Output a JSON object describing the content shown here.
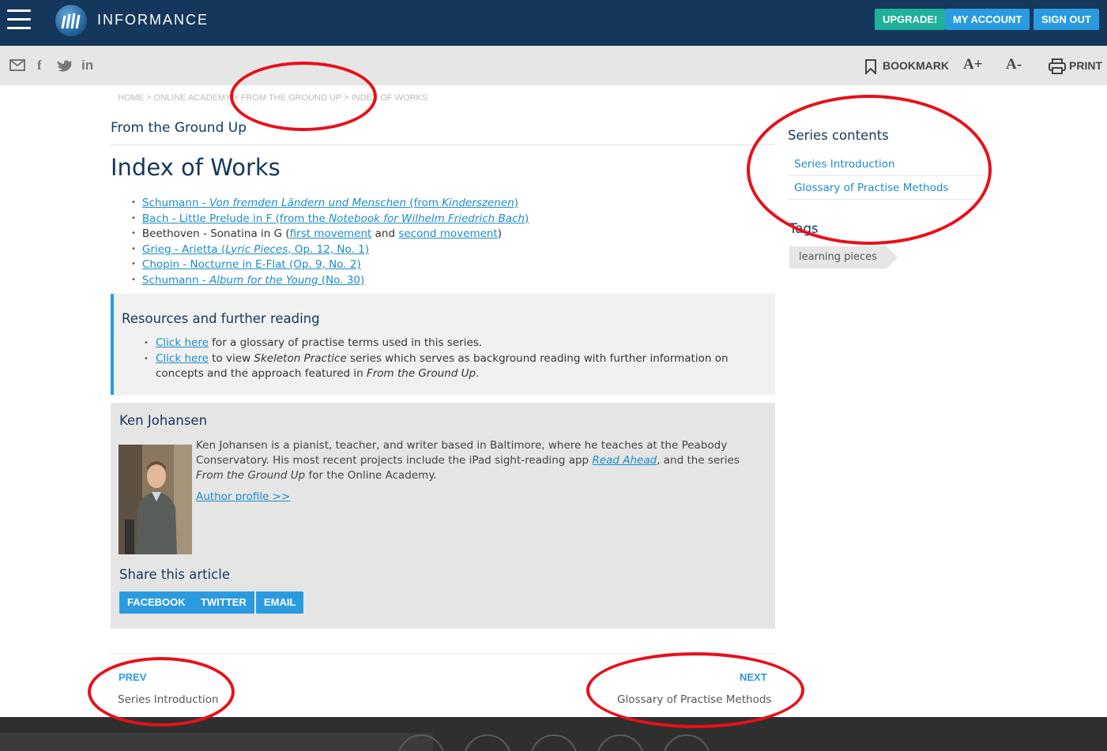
{
  "header": {
    "logo_text": "INFORMANCE",
    "upgrade": "UPGRADE!",
    "my_account": "MY ACCOUNT",
    "sign_out": "SIGN OUT"
  },
  "toolbar": {
    "bookmark": "BOOKMARK",
    "font_up": "A+",
    "font_down": "A-",
    "print": "PRINT"
  },
  "breadcrumb": [
    "HOME",
    "ONLINE ACADEMY",
    "FROM THE GROUND UP",
    "INDEX OF WORKS"
  ],
  "series_title": "From the Ground Up",
  "page_title": "Index of Works",
  "works": {
    "schumann1": {
      "a": "Schumann - ",
      "b": "Von fremden Ländern und Menschen",
      "c": " (from ",
      "d": "Kinderszenen",
      "e": ")"
    },
    "bach": {
      "a": "Bach - Little Prelude in F (from the ",
      "b": "Notebook for Wilhelm Friedrich Bach",
      "c": ")"
    },
    "beethoven": {
      "a": "Beethoven - Sonatina in G (",
      "b": "first movement",
      "c": " and ",
      "d": "second movement",
      "e": ")"
    },
    "grieg": {
      "a": "Grieg - Arietta (",
      "b": "Lyric Pieces",
      "c": ", Op. 12, No. 1)"
    },
    "chopin": {
      "a": "Chopin - Nocturne in E-Flat (Op. 9, No. 2)"
    },
    "schumann2": {
      "a": "Schumann - ",
      "b": "Album for the Young",
      "c": " (No. 30)"
    }
  },
  "resources": {
    "title": "Resources and further reading",
    "item1": {
      "link": "Click here",
      "text": " for a glossary of practise terms used in this series."
    },
    "item2": {
      "link": "Click here",
      "text1": " to view ",
      "italic1": "Skeleton Practice",
      "text2": " series which serves as background reading with further information on concepts and the approach featured in ",
      "italic2": "From the Ground Up",
      "text3": "."
    }
  },
  "author": {
    "name": "Ken Johansen",
    "bio1": "Ken Johansen is a pianist, teacher, and writer based in Baltimore, where he teaches at the Peabody Conservatory. His most recent projects include the iPad sight-reading app ",
    "bio_link": "Read Ahead",
    "bio2": ", and the series ",
    "bio_italic": "From the Ground Up",
    "bio3": " for the Online Academy.",
    "profile_link": "Author profile >>"
  },
  "share": {
    "title": "Share this article",
    "facebook": "FACEBOOK",
    "twitter": "TWITTER",
    "email": "EMAIL"
  },
  "sidebar": {
    "series_title": "Series contents",
    "items": [
      "Series Introduction",
      "Glossary of Practise Methods"
    ],
    "tags_title": "Tags",
    "tags": [
      "learning pieces"
    ]
  },
  "nav": {
    "prev_label": "PREV",
    "prev_title": "Series Introduction",
    "next_label": "NEXT",
    "next_title": "Glossary of Practise Methods"
  },
  "colors": {
    "header_bg": "#15375b",
    "accent_blue": "#2b9be0",
    "upgrade_green": "#1fb19a",
    "annotation_red": "#e8101a"
  }
}
